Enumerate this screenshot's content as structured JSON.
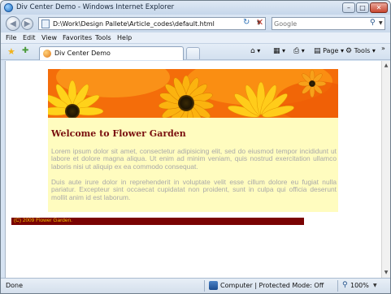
{
  "window": {
    "title": "Div Center Demo - Windows Internet Explorer"
  },
  "address_bar": {
    "url": "D:\\Work\\Design Pallete\\Article_codes\\default.html"
  },
  "search": {
    "placeholder": "Google"
  },
  "menu": {
    "items": [
      "File",
      "Edit",
      "View",
      "Favorites",
      "Tools",
      "Help"
    ]
  },
  "tabs": {
    "active_label": "Div Center Demo"
  },
  "command_bar": {
    "page_label": "Page",
    "tools_label": "Tools",
    "more": "»"
  },
  "page": {
    "heading": "Welcome to Flower Garden",
    "paragraph1": "Lorem ipsum dolor sit amet, consectetur adipisicing elit, sed do eiusmod tempor incididunt ut labore et dolore magna aliqua. Ut enim ad minim veniam, quis nostrud exercitation ullamco laboris nisi ut aliquip ex ea commodo consequat.",
    "paragraph2": "Duis aute irure dolor in reprehenderit in voluptate velit esse cillum dolore eu fugiat nulla pariatur. Excepteur sint occaecat cupidatat non proident, sunt in culpa qui officia deserunt mollit anim id est laborum.",
    "footer": "(C) 2009 Flower Garden.",
    "colors": {
      "heading": "#7a1010",
      "container_bg": "#fffcbf",
      "footer_bg": "#7a0303",
      "footer_text": "#f0c000",
      "paragraph_text": "#a9a9a9"
    }
  },
  "status_bar": {
    "left": "Done",
    "zone": "Computer | Protected Mode: Off",
    "zoom": "100%"
  }
}
